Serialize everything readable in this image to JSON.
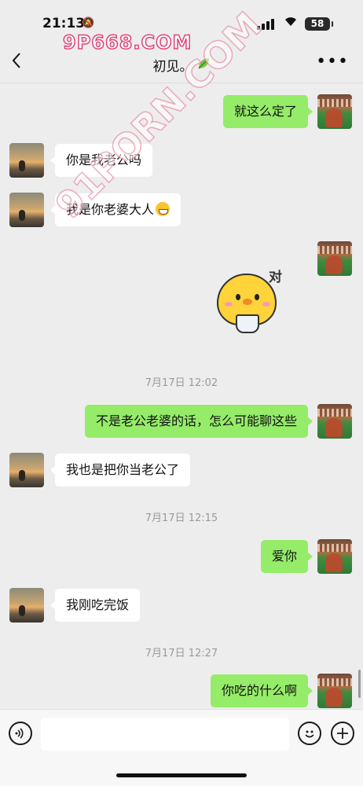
{
  "status_bar": {
    "time": "21:13",
    "battery": "58",
    "mute_icon": "bell-slash-icon",
    "signal_icon": "cellular-signal-icon",
    "wifi_icon": "wifi-icon"
  },
  "watermarks": {
    "top": "9P668.COM",
    "diagonal": "91PORN.COM"
  },
  "nav": {
    "title": "初见。",
    "back_icon": "chevron-left-icon",
    "leaf_icon": "leaf-icon",
    "more_icon": "more-dots-icon"
  },
  "messages": [
    {
      "side": "out",
      "text": "就这么定了"
    },
    {
      "side": "in",
      "text": "你是我老公吗"
    },
    {
      "side": "in",
      "text": "我是你老婆大人",
      "emoji": "grinning-face-icon"
    },
    {
      "side": "out",
      "type": "sticker",
      "text": "对",
      "sticker": "chick-holding-cup-sticker"
    },
    {
      "type": "time",
      "text": "7月17日 12:02"
    },
    {
      "side": "out",
      "text": "不是老公老婆的话，怎么可能聊这些"
    },
    {
      "side": "in",
      "text": "我也是把你当老公了"
    },
    {
      "type": "time",
      "text": "7月17日 12:15"
    },
    {
      "side": "out",
      "text": "爱你"
    },
    {
      "side": "in",
      "text": "我刚吃完饭"
    },
    {
      "type": "time",
      "text": "7月17日 12:27"
    },
    {
      "side": "out",
      "text": "你吃的什么啊"
    }
  ],
  "input_bar": {
    "voice_icon": "voice-icon",
    "emoji_icon": "emoji-icon",
    "plus_icon": "plus-icon",
    "placeholder": ""
  },
  "colors": {
    "outgoing_bubble": "#95ec69",
    "incoming_bubble": "#ffffff",
    "background": "#ededed"
  }
}
